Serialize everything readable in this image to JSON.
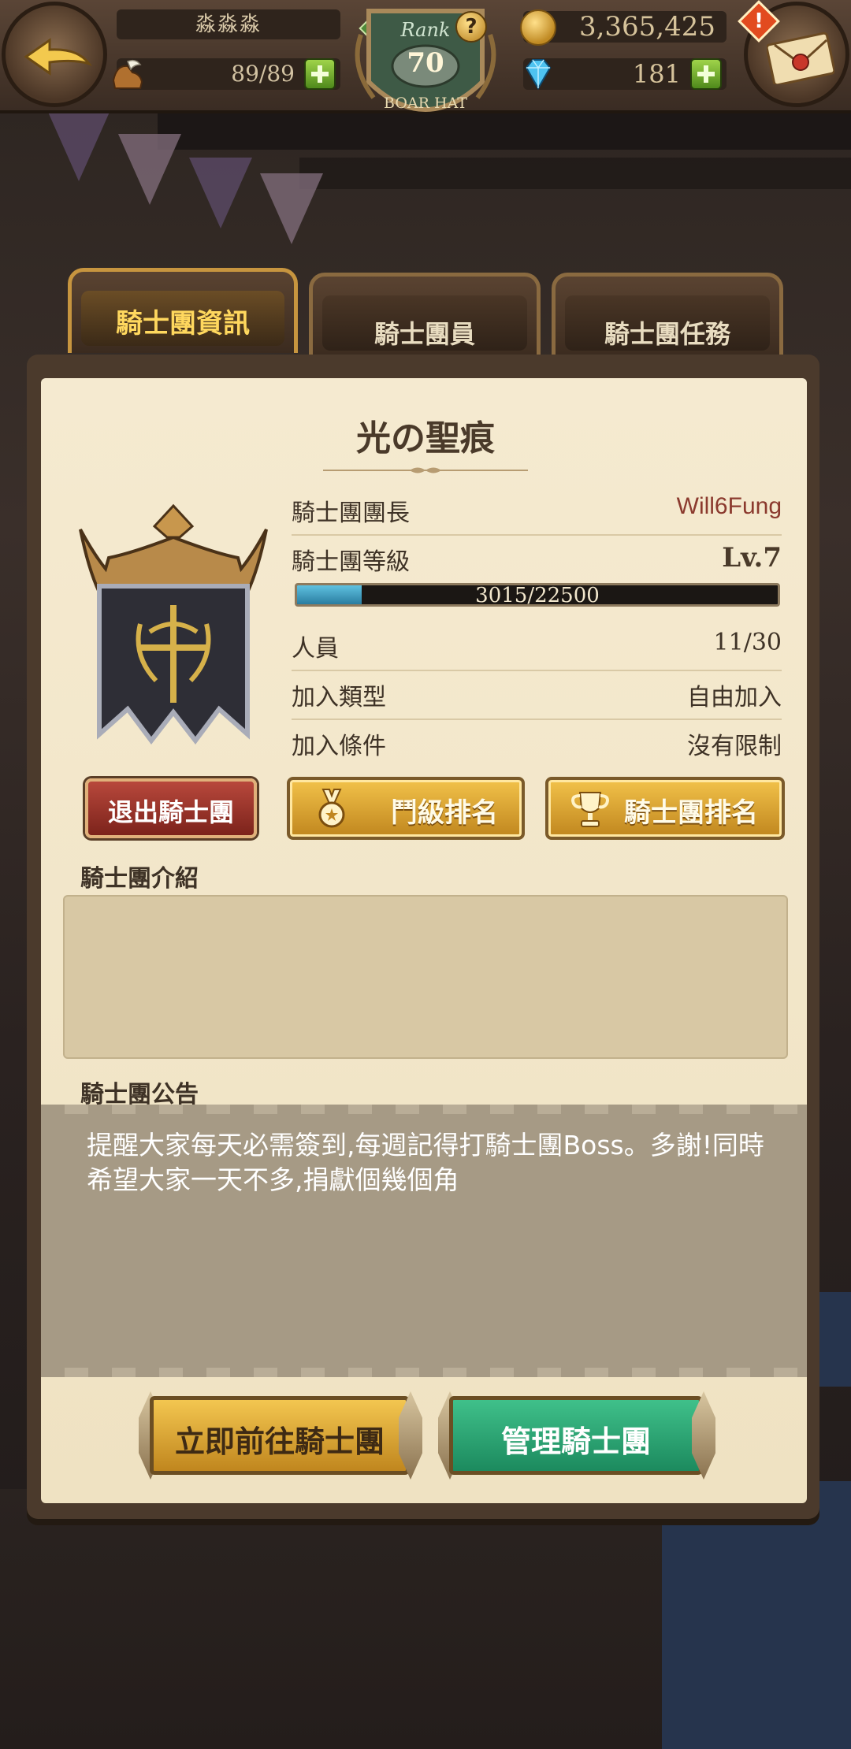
{
  "player": {
    "name": "淼淼淼",
    "stamina": "89/89",
    "rank_label": "Rank",
    "rank_value": "70",
    "rank_title": "BOAR HAT",
    "rank_badge": "B",
    "help": "?",
    "gold": "3,365,425",
    "gems": "181",
    "alert": "!"
  },
  "tabs": [
    {
      "label": "騎士團資訊",
      "active": true
    },
    {
      "label": "騎士團員",
      "active": false
    },
    {
      "label": "騎士團任務",
      "active": false
    }
  ],
  "guild": {
    "name": "光の聖痕",
    "leader_label": "騎士團團長",
    "leader_value": "Will6Fung",
    "level_label": "騎士團等級",
    "level_value": "Lv.7",
    "xp_text": "3015/22500",
    "xp_fraction": 0.134,
    "members_label": "人員",
    "members_value": "11/30",
    "join_type_label": "加入類型",
    "join_type_value": "自由加入",
    "join_cond_label": "加入條件",
    "join_cond_value": "沒有限制"
  },
  "buttons": {
    "leave": "退出騎士團",
    "rank_tier": "鬥級排名",
    "rank_guild": "騎士團排名",
    "goto": "立即前往騎士團",
    "manage": "管理騎士團"
  },
  "sections": {
    "intro_label": "騎士團介紹",
    "intro_text": "",
    "notice_label": "騎士團公告",
    "notice_text": "提醒大家每天必需簽到,每週記得打騎士團Boss。多謝!同時希望大家一天不多,捐獻個幾個角"
  },
  "icons": [
    "back-arrow-icon",
    "mail-icon",
    "alert-icon",
    "boot-icon",
    "plus-icon",
    "coin-icon",
    "gem-icon",
    "rank-badge-icon",
    "help-icon",
    "guild-emblem-icon",
    "medal-icon",
    "trophy-icon"
  ],
  "colors": {
    "accent_gold": "#f2c24a",
    "tab_active_text": "#ffd85e",
    "leave_red": "#9e3329",
    "manage_green": "#2aa873",
    "leader_name": "#8b3a2e"
  }
}
